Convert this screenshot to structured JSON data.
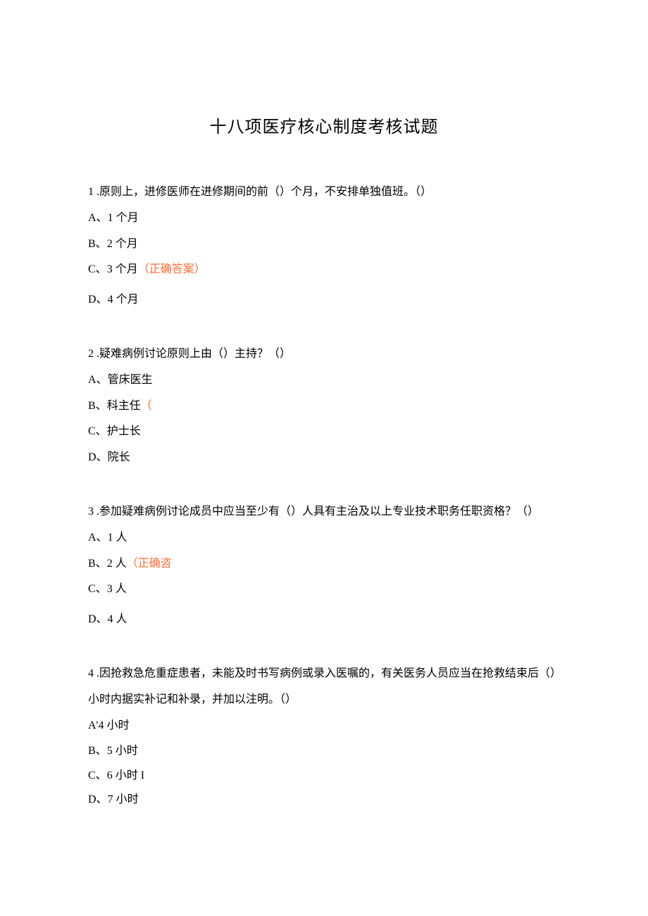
{
  "title": "十八项医疗核心制度考核试题",
  "questions": [
    {
      "stem": "1 .原则上，进修医师在进修期间的前（）个月，不安排单独值班。（）",
      "opts": [
        {
          "label": "A、",
          "text": "1 个月",
          "annot": ""
        },
        {
          "label": "B、",
          "text": "2 个月",
          "annot": ""
        },
        {
          "label": "C、",
          "text": "3 个月",
          "annot": "（正确答案）"
        },
        {
          "label": "D、",
          "text": "4 个月",
          "annot": ""
        }
      ]
    },
    {
      "stem": "2 .疑难病例讨论原则上由（）主持？（）",
      "opts": [
        {
          "label": "A、",
          "text": "管床医生",
          "annot": ""
        },
        {
          "label": "B、",
          "text": "科主任",
          "annot": "（"
        },
        {
          "label": "C、",
          "text": "护士长",
          "annot": ""
        },
        {
          "label": "D、",
          "text": "院长",
          "annot": ""
        }
      ]
    },
    {
      "stem": "3 .参加疑难病例讨论成员中应当至少有（）人具有主治及以上专业技术职务任职资格？（）",
      "opts": [
        {
          "label": "A、",
          "text": "1 人",
          "annot": ""
        },
        {
          "label": "B、",
          "text": "2 人",
          "annot": "（正确咨"
        },
        {
          "label": "C、",
          "text": "3 人",
          "annot": ""
        },
        {
          "label": "D、",
          "text": "4 人",
          "annot": ""
        }
      ]
    },
    {
      "stem": "4 .因抢救急危重症患者，未能及时书写病例或录入医嘱的，有关医务人员应当在抢救结束后（）小时内据实补记和补录，并加以注明。（）",
      "opts": [
        {
          "label": "A'",
          "text": "4 小时",
          "annot": ""
        },
        {
          "label": "B、",
          "text": "5 小时",
          "annot": ""
        },
        {
          "label": "C、",
          "text": "6 小时 I",
          "annot": ""
        },
        {
          "label": "D、",
          "text": "7 小时",
          "annot": ""
        }
      ]
    }
  ]
}
